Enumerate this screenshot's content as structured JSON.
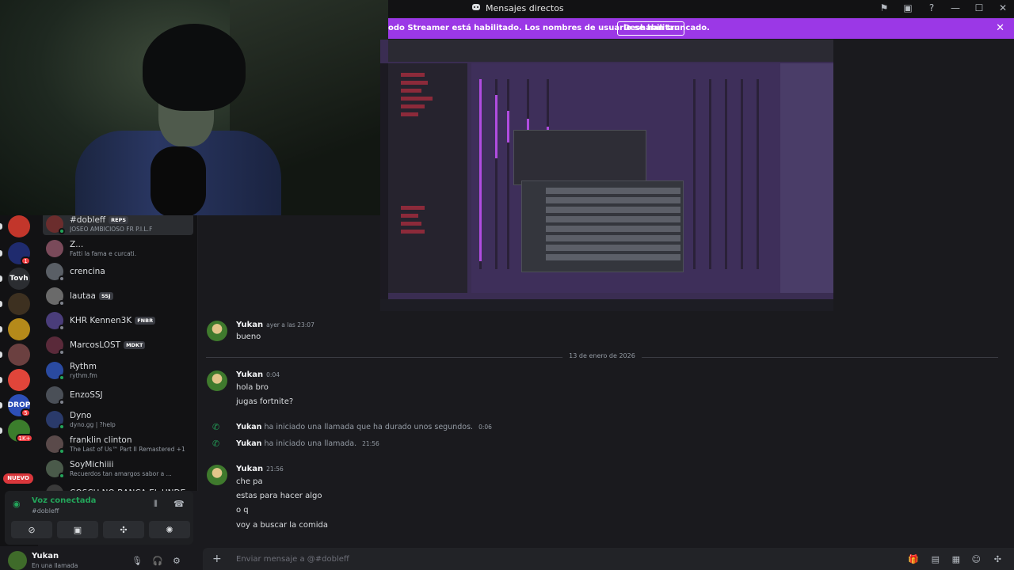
{
  "window": {
    "title": "Mensajes directos"
  },
  "banner": {
    "message": "odo Streamer está habilitado. Los nombres de usuario se han truncado.",
    "button": "Deshabilitar"
  },
  "rail": {
    "servers": [
      {
        "label": "",
        "color": "#c2362b",
        "badge": ""
      },
      {
        "label": "",
        "color": "#1f2b6e",
        "badge": "1"
      },
      {
        "label": "Tovh",
        "color": "#2b2d31",
        "badge": ""
      },
      {
        "label": "",
        "color": "#3d3020",
        "badge": ""
      },
      {
        "label": "",
        "color": "#b58a1a",
        "badge": ""
      },
      {
        "label": "",
        "color": "#6b4040",
        "badge": ""
      },
      {
        "label": "",
        "color": "#e0453a",
        "badge": ""
      },
      {
        "label": "DROP",
        "color": "#2d4fb8",
        "badge": "5"
      },
      {
        "label": "",
        "color": "#3b7d2c",
        "badge": "1K+"
      }
    ],
    "new_label": "NUEVO"
  },
  "dms": [
    {
      "name": "#dobleff",
      "tag": "REPS",
      "sub": "JOSEO AMBICIOSO FR P.I.L.F",
      "color": "#6b2d2d",
      "status": "#23a55a",
      "active": true
    },
    {
      "name": "Z...",
      "tag": "",
      "sub": "Fatti la fama e curcati.",
      "color": "#7a4a5a",
      "status": "",
      "active": false
    },
    {
      "name": "crencina",
      "tag": "",
      "sub": "",
      "color": "#5a5f66",
      "status": "#80848e",
      "active": false
    },
    {
      "name": "lautaa",
      "tag": "SSJ",
      "sub": "",
      "color": "#6a6a6a",
      "status": "#80848e",
      "active": false
    },
    {
      "name": "KHR Kennen3K",
      "tag": "FNBR",
      "sub": "",
      "color": "#4a3d7a",
      "status": "#80848e",
      "active": false
    },
    {
      "name": "MarcosLOST",
      "tag": "MDKT",
      "sub": "",
      "color": "#5a2a3a",
      "status": "#80848e",
      "active": false
    },
    {
      "name": "Rythm",
      "tag": "",
      "sub": "rythm.fm",
      "color": "#2a4aa0",
      "status": "#23a55a",
      "active": false
    },
    {
      "name": "EnzoSSJ",
      "tag": "",
      "sub": "",
      "color": "#4a4f57",
      "status": "#80848e",
      "active": false
    },
    {
      "name": "Dyno",
      "tag": "",
      "sub": "dyno.gg | ?help",
      "color": "#2a3a6a",
      "status": "#23a55a",
      "active": false
    },
    {
      "name": "franklin clinton",
      "tag": "",
      "sub": "The Last of Us™ Part II Remastered +1",
      "color": "#5a4a4a",
      "status": "#23a55a",
      "active": false
    },
    {
      "name": "SoyMichiiii",
      "tag": "",
      "sub": "Recuerdos tan amargos sabor a ...",
      "color": "#4a5a4a",
      "status": "#23a55a",
      "active": false
    },
    {
      "name": "COSCU NO BANCA EL UNDE",
      "tag": "",
      "sub": "",
      "color": "#3a3a3a",
      "status": "",
      "active": false
    }
  ],
  "voice": {
    "label": "Voz conectada",
    "channel": "#dobleff"
  },
  "user": {
    "name": "Yukan",
    "status": "En una llamada"
  },
  "chat": {
    "msg1": {
      "author": "Yukan",
      "time": "ayer a las 23:07",
      "lines": [
        "bueno"
      ]
    },
    "divider": "13 de enero de 2026",
    "msg2": {
      "author": "Yukan",
      "time": "0:04",
      "lines": [
        "hola bro",
        "jugas fortnite?"
      ]
    },
    "call1": {
      "author": "Yukan",
      "text": "ha iniciado una llamada que ha durado unos segundos.",
      "time": "0:06"
    },
    "call2": {
      "author": "Yukan",
      "text": "ha iniciado una llamada.",
      "time": "21:56"
    },
    "msg3": {
      "author": "Yukan",
      "time": "21:56",
      "lines": [
        "che pa",
        "estas para hacer algo",
        "o q",
        "voy a buscar la comida"
      ]
    }
  },
  "composer": {
    "placeholder": "Enviar mensaje a @#dobleff"
  }
}
